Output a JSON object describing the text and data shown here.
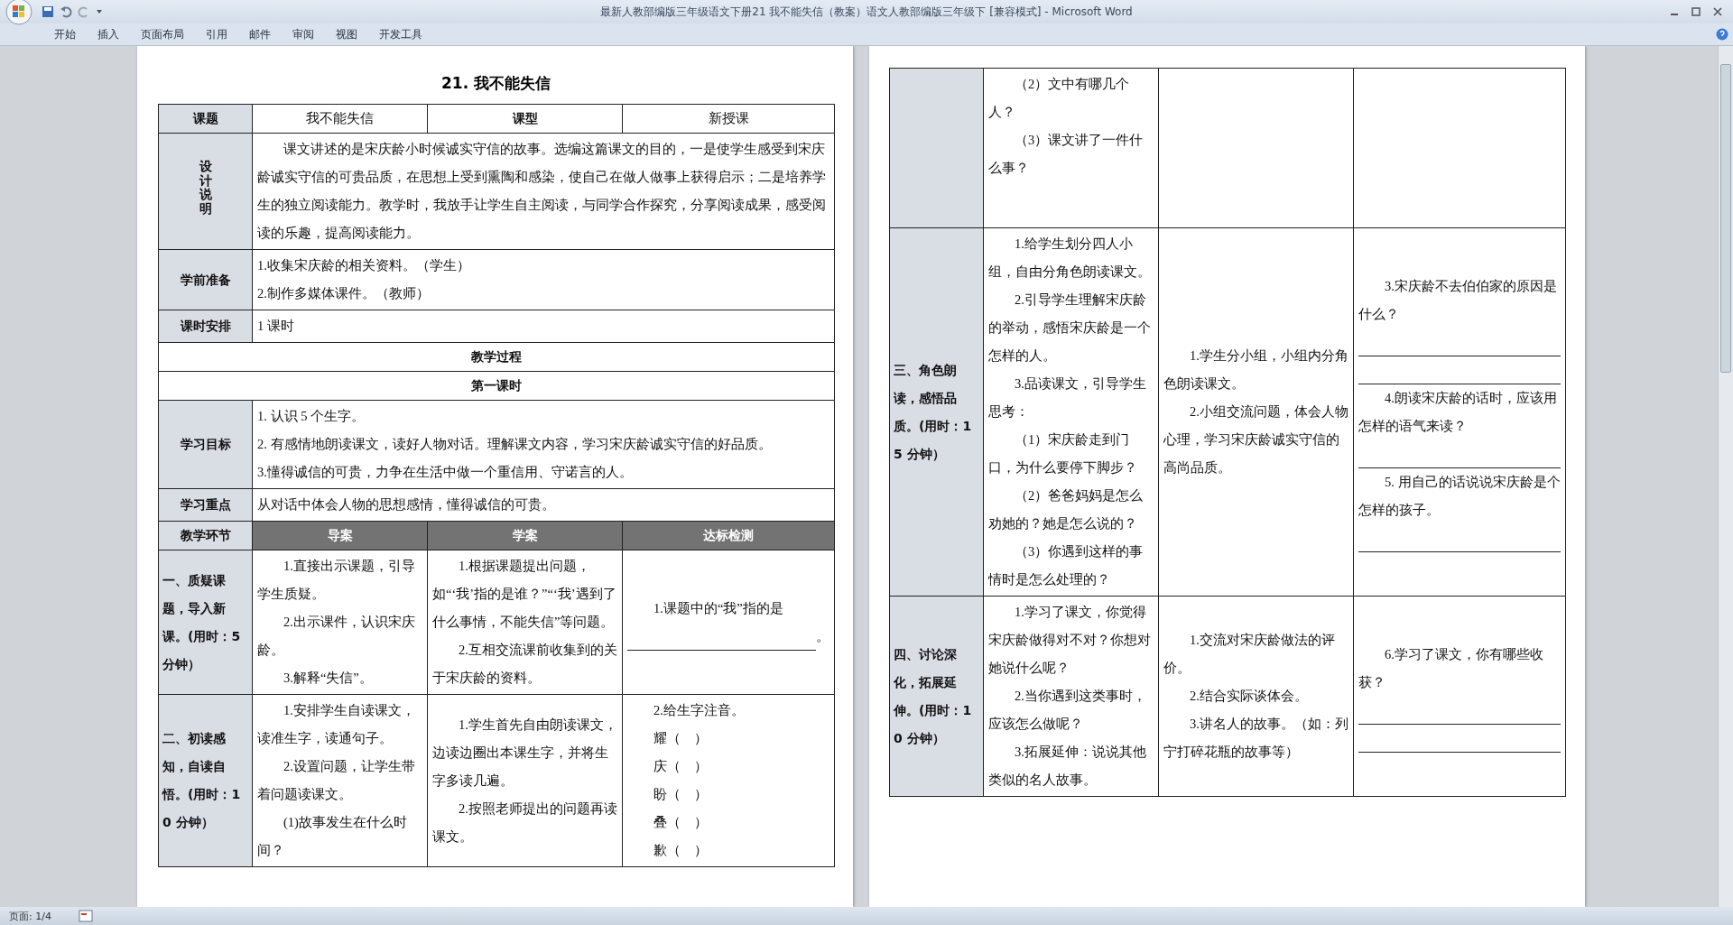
{
  "window": {
    "title": "最新人教部编版三年级语文下册21 我不能失信（教案）语文人教部编版三年级下 [兼容模式] - Microsoft Word"
  },
  "ribbon_tabs": [
    "开始",
    "插入",
    "页面布局",
    "引用",
    "邮件",
    "审阅",
    "视图",
    "开发工具"
  ],
  "left_page": {
    "heading": "21. 我不能失信",
    "rows": [
      {
        "kind": "pair",
        "cells": [
          "课题",
          "我不能失信",
          "课型",
          "新授课"
        ]
      },
      {
        "kind": "vertical_label",
        "label": "设计说明",
        "paragraphs": [
          {
            "kind": "indented",
            "text": "课文讲述的是宋庆龄小时候诚实守信的故事。选编这篇课文的目的，一是使学生感受到宋庆龄诚实守信的可贵品质，在思想上受到熏陶和感染，使自己在做人做事上获得启示；二是培养学生的独立阅读能力。教学时，我放手让学生自主阅读，与同学合作探究，分享阅读成果，感受阅读的乐趣，提高阅读能力。"
          }
        ]
      },
      {
        "kind": "label",
        "label": "学前准备",
        "paragraphs": [
          {
            "kind": "text",
            "text": "1.收集宋庆龄的相关资料。（学生）"
          },
          {
            "kind": "text",
            "text": "2.制作多媒体课件。（教师）"
          }
        ]
      },
      {
        "kind": "label",
        "label": "课时安排",
        "paragraphs": [
          {
            "kind": "text",
            "text": "1 课时"
          }
        ]
      },
      {
        "kind": "section",
        "text": "教学过程"
      },
      {
        "kind": "section",
        "text": "第一课时"
      },
      {
        "kind": "label",
        "label": "学习目标",
        "paragraphs": [
          {
            "kind": "text",
            "text": "1. 认识 5 个生字。"
          },
          {
            "kind": "text",
            "text": "2. 有感情地朗读课文，读好人物对话。理解课文内容，学习宋庆龄诚实守信的好品质。"
          },
          {
            "kind": "text",
            "text": "3.懂得诚信的可贵，力争在生活中做一个重信用、守诺言的人。"
          }
        ]
      },
      {
        "kind": "label",
        "label": "学习重点",
        "paragraphs": [
          {
            "kind": "text",
            "text": "从对话中体会人物的思想感情，懂得诚信的可贵。"
          }
        ]
      },
      {
        "kind": "header",
        "cells": [
          "教学环节",
          "导案",
          "学案",
          "达标检测"
        ]
      },
      {
        "kind": "step",
        "label": "一、质疑课题，导入新课。(用时：5 分钟）",
        "columns": [
          [
            {
              "kind": "indented",
              "text": "1.直接出示课题，引导学生质疑。"
            },
            {
              "kind": "indented",
              "text": "2.出示课件，认识宋庆龄。"
            },
            {
              "kind": "indented",
              "text": "3.解释“失信”。"
            }
          ],
          [
            {
              "kind": "indented",
              "text": "1.根据课题提出问题，如“‘我’指的是谁？”“‘我’遇到了什么事情，不能失信”等问题。"
            },
            {
              "kind": "indented",
              "text": "2.互相交流课前收集到的关于宋庆龄的资料。"
            }
          ],
          [
            {
              "kind": "indented",
              "text": "1.课题中的“我”指的是"
            },
            {
              "kind": "blank",
              "suffix": "。"
            }
          ]
        ]
      },
      {
        "kind": "step",
        "label": "二、初读感知，自读自悟。(用时：10 分钟）",
        "columns": [
          [
            {
              "kind": "indented",
              "text": "1.安排学生自读课文，读准生字，读通句子。"
            },
            {
              "kind": "indented",
              "text": "2.设置问题，让学生带着问题读课文。"
            },
            {
              "kind": "indented",
              "text": "(1)故事发生在什么时间？"
            }
          ],
          [
            {
              "kind": "indented",
              "text": "1.学生首先自由朗读课文，边读边圈出本课生字，并将生字多读几遍。"
            },
            {
              "kind": "indented",
              "text": "2.按照老师提出的问题再读课文。"
            }
          ],
          [
            {
              "kind": "indented",
              "text": "2.给生字注音。"
            },
            {
              "kind": "indented",
              "text": "耀（    ）"
            },
            {
              "kind": "indented",
              "text": "庆（    ）"
            },
            {
              "kind": "indented",
              "text": "盼（    ）"
            },
            {
              "kind": "indented",
              "text": "叠（    ）"
            },
            {
              "kind": "indented",
              "text": "歉（    ）"
            }
          ]
        ]
      }
    ]
  },
  "right_page": {
    "rows": [
      {
        "kind": "continued",
        "columns": [
          [
            {
              "kind": "indented",
              "text": "（2）文中有哪几个人？"
            },
            {
              "kind": "indented",
              "text": "（3）课文讲了一件什么事？"
            }
          ],
          [],
          []
        ]
      },
      {
        "kind": "step",
        "label": "三、角色朗读，感悟品质。(用时：15 分钟）",
        "columns": [
          [
            {
              "kind": "indented",
              "text": "1.给学生划分四人小组，自由分角色朗读课文。"
            },
            {
              "kind": "indented",
              "text": "2.引导学生理解宋庆龄的举动，感悟宋庆龄是一个怎样的人。"
            },
            {
              "kind": "indented",
              "text": "3.品读课文，引导学生思考："
            },
            {
              "kind": "indented",
              "text": "（1）宋庆龄走到门口，为什么要停下脚步？"
            },
            {
              "kind": "indented",
              "text": "（2）爸爸妈妈是怎么劝她的？她是怎么说的？"
            },
            {
              "kind": "indented",
              "text": "（3）你遇到这样的事情时是怎么处理的？"
            }
          ],
          [
            {
              "kind": "indented",
              "text": "1.学生分小组，小组内分角色朗读课文。"
            },
            {
              "kind": "indented",
              "text": "2.小组交流问题，体会人物心理，学习宋庆龄诚实守信的高尚品质。"
            }
          ],
          [
            {
              "kind": "indented",
              "text": "3.宋庆龄不去伯伯家的原因是什么？"
            },
            {
              "kind": "blank"
            },
            {
              "kind": "blank"
            },
            {
              "kind": "indented",
              "text": "4.朗读宋庆龄的话时，应该用怎样的语气来读？"
            },
            {
              "kind": "blank"
            },
            {
              "kind": "indented",
              "text": "5. 用自己的话说说宋庆龄是个怎样的孩子。"
            },
            {
              "kind": "blank"
            }
          ]
        ]
      },
      {
        "kind": "step",
        "label": "四、讨论深化，拓展延伸。(用时：10 分钟）",
        "columns": [
          [
            {
              "kind": "indented",
              "text": "1.学习了课文，你觉得宋庆龄做得对不对？你想对她说什么呢？"
            },
            {
              "kind": "indented",
              "text": "2.当你遇到这类事时，应该怎么做呢？"
            },
            {
              "kind": "indented",
              "text": "3.拓展延伸：说说其他类似的名人故事。"
            }
          ],
          [
            {
              "kind": "indented",
              "text": "1.交流对宋庆龄做法的评价。"
            },
            {
              "kind": "indented",
              "text": "2.结合实际谈体会。"
            },
            {
              "kind": "indented",
              "text": "3.讲名人的故事。（如：列宁打碎花瓶的故事等）"
            }
          ],
          [
            {
              "kind": "indented",
              "text": "6.学习了课文，你有哪些收获？"
            },
            {
              "kind": "blank"
            },
            {
              "kind": "blank"
            }
          ]
        ]
      }
    ]
  },
  "status_bar": {
    "page": "页面: 1/4"
  }
}
